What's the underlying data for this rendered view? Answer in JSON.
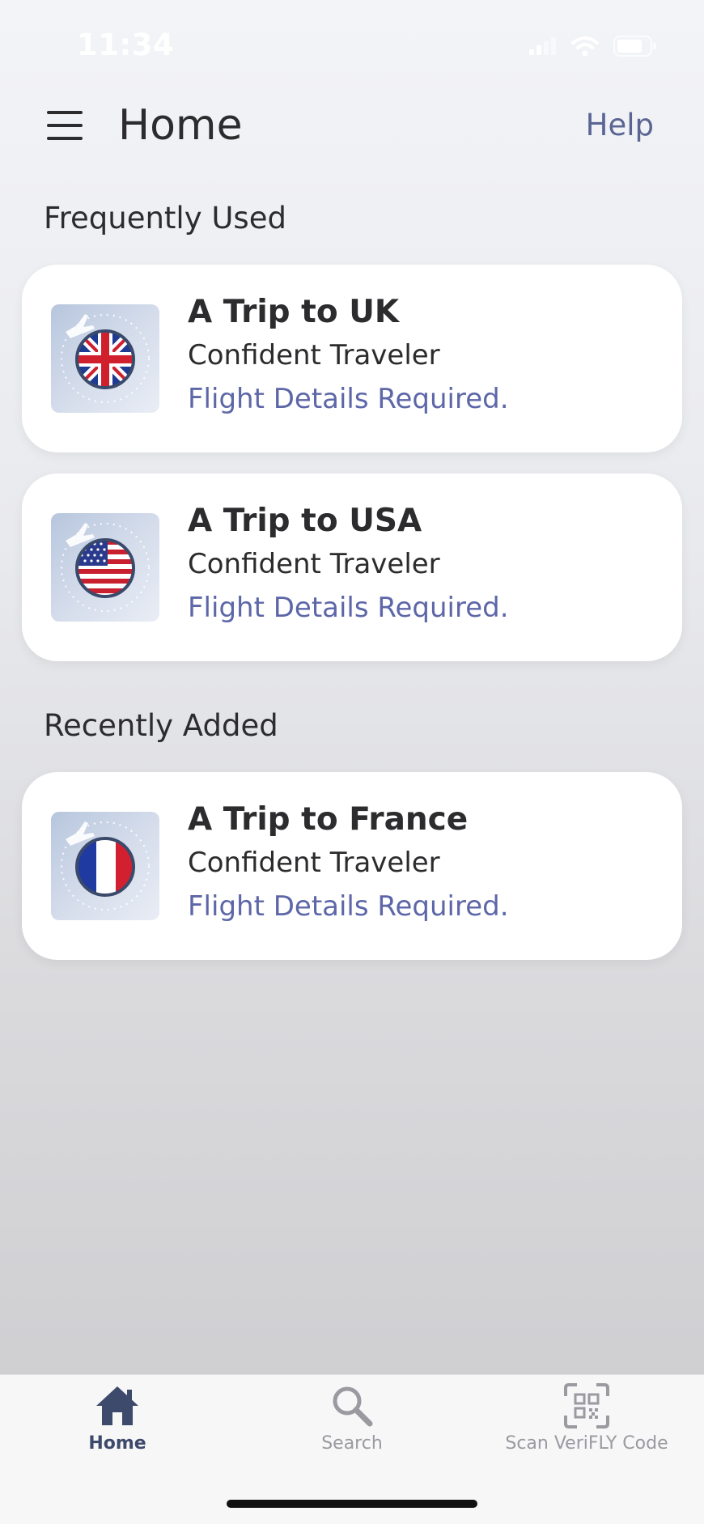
{
  "status_bar": {
    "time": "11:34",
    "icons": [
      "cellular-signal-icon",
      "wifi-icon",
      "battery-icon"
    ]
  },
  "header": {
    "menu_icon": "hamburger-menu-icon",
    "title": "Home",
    "help_label": "Help"
  },
  "sections": {
    "frequent": {
      "label": "Frequently Used",
      "cards": [
        {
          "title": "A Trip to UK",
          "subtitle": "Confident Traveler",
          "status": "Flight Details Required.",
          "icon": "uk-flag-icon"
        },
        {
          "title": "A Trip to USA",
          "subtitle": "Confident Traveler",
          "status": "Flight Details Required.",
          "icon": "usa-flag-icon"
        }
      ]
    },
    "recent": {
      "label": "Recently Added",
      "cards": [
        {
          "title": "A Trip to France",
          "subtitle": "Confident Traveler",
          "status": "Flight Details Required.",
          "icon": "france-flag-icon"
        }
      ]
    }
  },
  "tab_bar": {
    "tabs": [
      {
        "label": "Home",
        "icon": "home-icon",
        "active": true
      },
      {
        "label": "Search",
        "icon": "search-icon",
        "active": false
      },
      {
        "label": "Scan VeriFLY Code",
        "icon": "qr-scan-icon",
        "active": false
      }
    ]
  },
  "colors": {
    "accent": "#5d67a8",
    "help_link": "#5b6594",
    "active_tab": "#3e4a6b",
    "inactive_tab": "#9a9aa0",
    "card_background": "#ffffff"
  }
}
